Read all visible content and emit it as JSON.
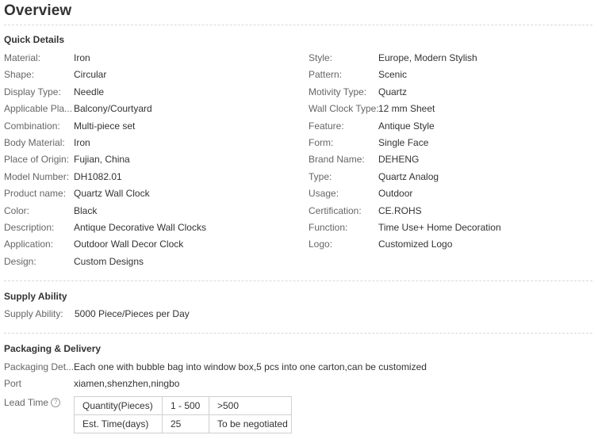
{
  "overview_title": "Overview",
  "quick_details": {
    "title": "Quick Details",
    "left": [
      {
        "label": "Material:",
        "value": "Iron"
      },
      {
        "label": "Shape:",
        "value": "Circular"
      },
      {
        "label": "Display Type:",
        "value": "Needle"
      },
      {
        "label": "Applicable Pla...",
        "value": "Balcony/Courtyard"
      },
      {
        "label": "Combination:",
        "value": "Multi-piece set"
      },
      {
        "label": "Body Material:",
        "value": "Iron"
      },
      {
        "label": "Place of Origin:",
        "value": "Fujian, China"
      },
      {
        "label": "Model Number:",
        "value": "DH1082.01"
      },
      {
        "label": "Product name:",
        "value": "Quartz Wall Clock"
      },
      {
        "label": "Color:",
        "value": "Black"
      },
      {
        "label": "Description:",
        "value": "Antique Decorative Wall Clocks"
      },
      {
        "label": "Application:",
        "value": "Outdoor Wall Decor Clock"
      },
      {
        "label": "Design:",
        "value": "Custom Designs"
      }
    ],
    "right": [
      {
        "label": "Style:",
        "value": "Europe, Modern Stylish"
      },
      {
        "label": "Pattern:",
        "value": "Scenic"
      },
      {
        "label": "Motivity Type:",
        "value": "Quartz"
      },
      {
        "label": "Wall Clock Type:",
        "value": "12 mm Sheet"
      },
      {
        "label": "Feature:",
        "value": "Antique Style"
      },
      {
        "label": "Form:",
        "value": "Single Face"
      },
      {
        "label": "Brand Name:",
        "value": "DEHENG"
      },
      {
        "label": "Type:",
        "value": "Quartz Analog"
      },
      {
        "label": "Usage:",
        "value": "Outdoor"
      },
      {
        "label": "Certification:",
        "value": "CE.ROHS"
      },
      {
        "label": "Function:",
        "value": "Time Use+ Home Decoration"
      },
      {
        "label": "Logo:",
        "value": "Customized Logo"
      }
    ]
  },
  "supply_ability": {
    "title": "Supply Ability",
    "label": "Supply Ability:",
    "value": "5000 Piece/Pieces per Day"
  },
  "packaging": {
    "title": "Packaging & Delivery",
    "details_label": "Packaging Det...",
    "details_value": "Each one with bubble bag into window box,5 pcs into one carton,can be customized",
    "port_label": "Port",
    "port_value": "xiamen,shenzhen,ningbo",
    "lead_time_label": "Lead Time",
    "help_icon": "?",
    "lead_table": {
      "row1": [
        "Quantity(Pieces)",
        "1 - 500",
        ">500"
      ],
      "row2": [
        "Est. Time(days)",
        "25",
        "To be negotiated"
      ]
    }
  }
}
